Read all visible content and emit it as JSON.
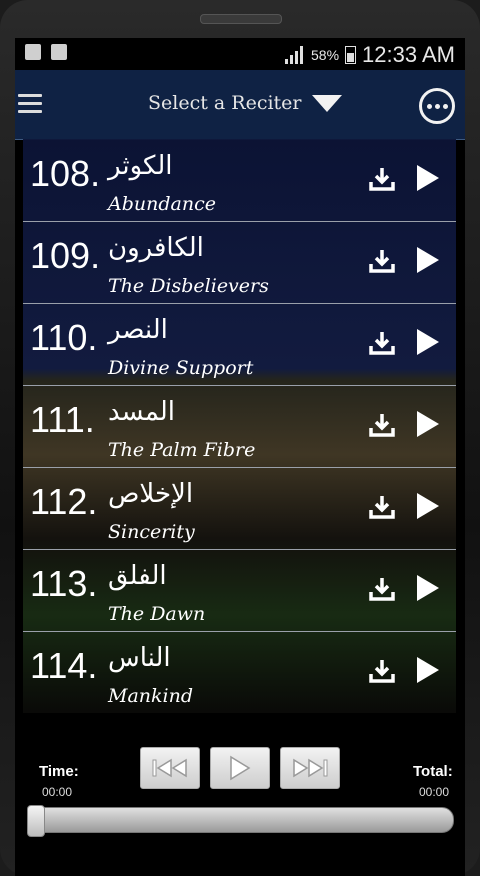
{
  "status": {
    "battery": "58%",
    "clock": "12:33 AM"
  },
  "header": {
    "title": "Select a Reciter"
  },
  "surahs": [
    {
      "number": "108.",
      "arabic": "الكوثر",
      "english": "Abundance"
    },
    {
      "number": "109.",
      "arabic": "الكافرون",
      "english": "The Disbelievers"
    },
    {
      "number": "110.",
      "arabic": "النصر",
      "english": "Divine Support"
    },
    {
      "number": "111.",
      "arabic": "المسد",
      "english": "The Palm Fibre"
    },
    {
      "number": "112.",
      "arabic": "الإخلاص",
      "english": "Sincerity"
    },
    {
      "number": "113.",
      "arabic": "الفلق",
      "english": "The Dawn"
    },
    {
      "number": "114.",
      "arabic": "الناس",
      "english": "Mankind"
    }
  ],
  "player": {
    "time_label": "Time:",
    "time_value": "00:00",
    "total_label": "Total:",
    "total_value": "00:00",
    "progress": 0
  },
  "colors": {
    "header_bg": "#0f2244",
    "text": "#ffffff"
  }
}
